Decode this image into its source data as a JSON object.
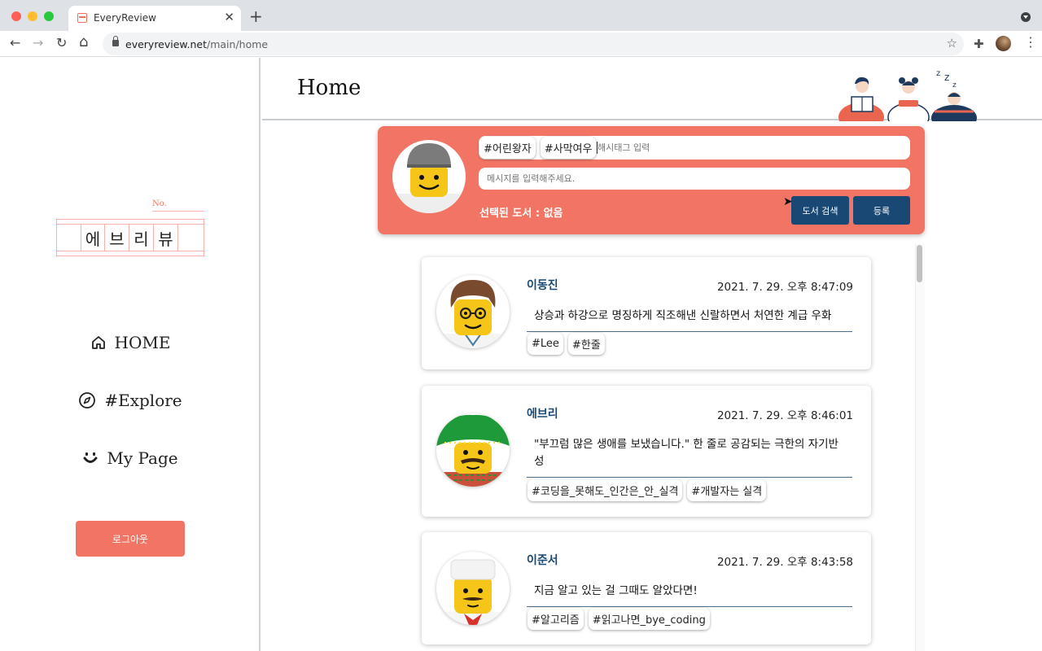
{
  "browser": {
    "tab_title": "EveryReview",
    "tab_close": "✕",
    "new_tab": "+",
    "url_domain": "everyreview.net",
    "url_path": "/main/home",
    "nav_back": "←",
    "nav_forward": "→",
    "nav_reload": "↻",
    "nav_home": "⌂",
    "bookmark_star": "☆",
    "extensions": "✚",
    "menu": "⋮"
  },
  "sidebar": {
    "logo_no": "No.",
    "logo_chars": [
      "에",
      "브",
      "리",
      "뷰"
    ],
    "nav": [
      {
        "label": "HOME",
        "icon": "home-icon"
      },
      {
        "label": "#Explore",
        "icon": "compass-icon"
      },
      {
        "label": "My Page",
        "icon": "smile-icon"
      }
    ],
    "logout_label": "로그아웃"
  },
  "header": {
    "title": "Home",
    "illustration": "people-reading-illustration"
  },
  "composer": {
    "hashtags": [
      "#어린왕자",
      "#사막여우"
    ],
    "hashtag_placeholder": "해시태그 입력",
    "message_placeholder": "메시지를 입력해주세요.",
    "selected_book": "선택된 도서 : 없음",
    "search_button": "도서 검색",
    "submit_button": "등록"
  },
  "posts": [
    {
      "author": "이동진",
      "time": "2021. 7. 29. 오후 8:47:09",
      "message": "상승과 하강으로 명징하게 직조해낸 신랄하면서 처연한 계급 우화",
      "tags": [
        "#Lee",
        "#한줄"
      ],
      "avatar": "lego-brown-hair-glasses"
    },
    {
      "author": "에브리",
      "time": "2021. 7. 29. 오후 8:46:01",
      "message": "\"부끄럼 많은 생애를 보냈습니다.\" 한 줄로 공감되는 극한의 자기반성",
      "tags": [
        "#코딩을_못해도_인간은_안_실격",
        "#개발자는 실격"
      ],
      "avatar": "lego-sombrero-mustache"
    },
    {
      "author": "이준서",
      "time": "2021. 7. 29. 오후 8:43:58",
      "message": "지금 알고 있는 걸 그때도 알았다면!",
      "tags": [
        "#알고리즘",
        "#읽고나면_bye_coding"
      ],
      "avatar": "lego-chef"
    }
  ],
  "colors": {
    "accent": "#f27464",
    "primary": "#1a4874"
  }
}
